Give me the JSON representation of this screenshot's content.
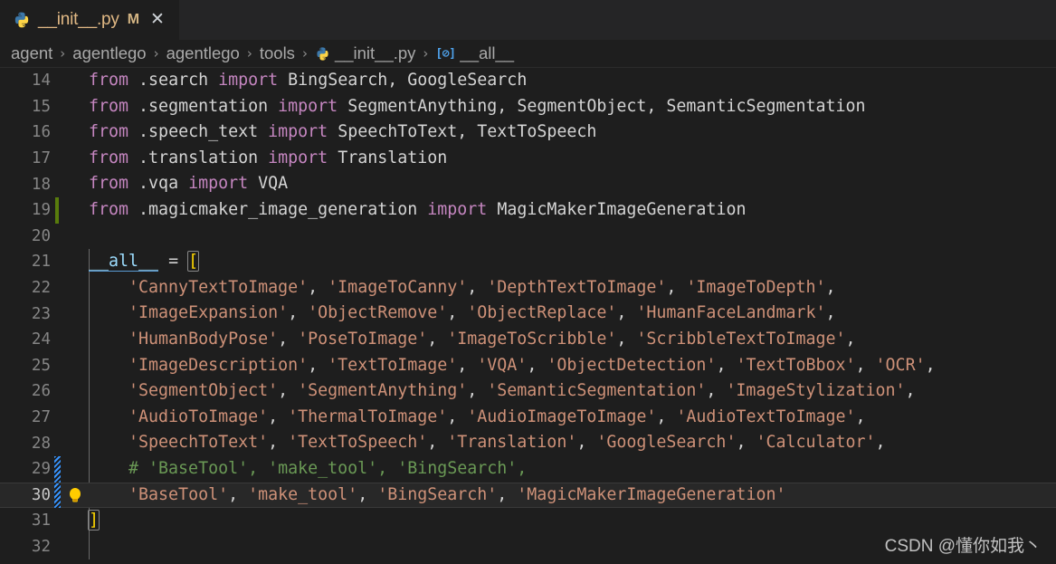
{
  "tab": {
    "icon": "python-file-icon",
    "filename": "__init__.py",
    "dirty_badge": "M",
    "close_label": "✕"
  },
  "breadcrumb": {
    "separator": "›",
    "items": [
      {
        "label": "agent",
        "icon": null
      },
      {
        "label": "agentlego",
        "icon": null
      },
      {
        "label": "agentlego",
        "icon": null
      },
      {
        "label": "tools",
        "icon": null
      },
      {
        "label": "__init__.py",
        "icon": "python-file-icon"
      },
      {
        "label": "__all__",
        "icon": "variable-symbol-icon"
      }
    ],
    "symbol_glyph": "[⊘]"
  },
  "editor": {
    "language": "python",
    "active_line": 30,
    "lines": [
      {
        "n": 14,
        "gutter": "none",
        "bulb": false,
        "tokens": [
          {
            "t": "from",
            "c": "kw"
          },
          {
            "t": " ",
            "c": "punc"
          },
          {
            "t": ".search",
            "c": "mod"
          },
          {
            "t": " ",
            "c": "punc"
          },
          {
            "t": "import",
            "c": "kw"
          },
          {
            "t": " ",
            "c": "punc"
          },
          {
            "t": "BingSearch, GoogleSearch",
            "c": "name"
          }
        ]
      },
      {
        "n": 15,
        "gutter": "none",
        "bulb": false,
        "tokens": [
          {
            "t": "from",
            "c": "kw"
          },
          {
            "t": " ",
            "c": "punc"
          },
          {
            "t": ".segmentation",
            "c": "mod"
          },
          {
            "t": " ",
            "c": "punc"
          },
          {
            "t": "import",
            "c": "kw"
          },
          {
            "t": " ",
            "c": "punc"
          },
          {
            "t": "SegmentAnything, SegmentObject, SemanticSegmentation",
            "c": "name"
          }
        ]
      },
      {
        "n": 16,
        "gutter": "none",
        "bulb": false,
        "tokens": [
          {
            "t": "from",
            "c": "kw"
          },
          {
            "t": " ",
            "c": "punc"
          },
          {
            "t": ".speech_text",
            "c": "mod"
          },
          {
            "t": " ",
            "c": "punc"
          },
          {
            "t": "import",
            "c": "kw"
          },
          {
            "t": " ",
            "c": "punc"
          },
          {
            "t": "SpeechToText, TextToSpeech",
            "c": "name"
          }
        ]
      },
      {
        "n": 17,
        "gutter": "none",
        "bulb": false,
        "tokens": [
          {
            "t": "from",
            "c": "kw"
          },
          {
            "t": " ",
            "c": "punc"
          },
          {
            "t": ".translation",
            "c": "mod"
          },
          {
            "t": " ",
            "c": "punc"
          },
          {
            "t": "import",
            "c": "kw"
          },
          {
            "t": " ",
            "c": "punc"
          },
          {
            "t": "Translation",
            "c": "name"
          }
        ]
      },
      {
        "n": 18,
        "gutter": "none",
        "bulb": false,
        "tokens": [
          {
            "t": "from",
            "c": "kw"
          },
          {
            "t": " ",
            "c": "punc"
          },
          {
            "t": ".vqa",
            "c": "mod"
          },
          {
            "t": " ",
            "c": "punc"
          },
          {
            "t": "import",
            "c": "kw"
          },
          {
            "t": " ",
            "c": "punc"
          },
          {
            "t": "VQA",
            "c": "name"
          }
        ]
      },
      {
        "n": 19,
        "gutter": "added",
        "bulb": false,
        "tokens": [
          {
            "t": "from",
            "c": "kw"
          },
          {
            "t": " ",
            "c": "punc"
          },
          {
            "t": ".magicmaker_image_generation",
            "c": "mod"
          },
          {
            "t": " ",
            "c": "punc"
          },
          {
            "t": "import",
            "c": "kw"
          },
          {
            "t": " ",
            "c": "punc"
          },
          {
            "t": "MagicMakerImageGeneration",
            "c": "name"
          }
        ]
      },
      {
        "n": 20,
        "gutter": "none",
        "bulb": false,
        "tokens": []
      },
      {
        "n": 21,
        "gutter": "none",
        "bulb": false,
        "tokens": [
          {
            "t": "__all__",
            "c": "var underline-sym"
          },
          {
            "t": " ",
            "c": "punc"
          },
          {
            "t": "=",
            "c": "op"
          },
          {
            "t": " ",
            "c": "punc"
          },
          {
            "t": "[",
            "c": "brk brk-match"
          }
        ]
      },
      {
        "n": 22,
        "gutter": "none",
        "bulb": false,
        "tokens": [
          {
            "t": "    ",
            "c": "punc"
          },
          {
            "t": "'CannyTextToImage'",
            "c": "str"
          },
          {
            "t": ", ",
            "c": "punc"
          },
          {
            "t": "'ImageToCanny'",
            "c": "str"
          },
          {
            "t": ", ",
            "c": "punc"
          },
          {
            "t": "'DepthTextToImage'",
            "c": "str"
          },
          {
            "t": ", ",
            "c": "punc"
          },
          {
            "t": "'ImageToDepth'",
            "c": "str"
          },
          {
            "t": ",",
            "c": "punc"
          }
        ]
      },
      {
        "n": 23,
        "gutter": "none",
        "bulb": false,
        "tokens": [
          {
            "t": "    ",
            "c": "punc"
          },
          {
            "t": "'ImageExpansion'",
            "c": "str"
          },
          {
            "t": ", ",
            "c": "punc"
          },
          {
            "t": "'ObjectRemove'",
            "c": "str"
          },
          {
            "t": ", ",
            "c": "punc"
          },
          {
            "t": "'ObjectReplace'",
            "c": "str"
          },
          {
            "t": ", ",
            "c": "punc"
          },
          {
            "t": "'HumanFaceLandmark'",
            "c": "str"
          },
          {
            "t": ",",
            "c": "punc"
          }
        ]
      },
      {
        "n": 24,
        "gutter": "none",
        "bulb": false,
        "tokens": [
          {
            "t": "    ",
            "c": "punc"
          },
          {
            "t": "'HumanBodyPose'",
            "c": "str"
          },
          {
            "t": ", ",
            "c": "punc"
          },
          {
            "t": "'PoseToImage'",
            "c": "str"
          },
          {
            "t": ", ",
            "c": "punc"
          },
          {
            "t": "'ImageToScribble'",
            "c": "str"
          },
          {
            "t": ", ",
            "c": "punc"
          },
          {
            "t": "'ScribbleTextToImage'",
            "c": "str"
          },
          {
            "t": ",",
            "c": "punc"
          }
        ]
      },
      {
        "n": 25,
        "gutter": "none",
        "bulb": false,
        "tokens": [
          {
            "t": "    ",
            "c": "punc"
          },
          {
            "t": "'ImageDescription'",
            "c": "str"
          },
          {
            "t": ", ",
            "c": "punc"
          },
          {
            "t": "'TextToImage'",
            "c": "str"
          },
          {
            "t": ", ",
            "c": "punc"
          },
          {
            "t": "'VQA'",
            "c": "str"
          },
          {
            "t": ", ",
            "c": "punc"
          },
          {
            "t": "'ObjectDetection'",
            "c": "str"
          },
          {
            "t": ", ",
            "c": "punc"
          },
          {
            "t": "'TextToBbox'",
            "c": "str"
          },
          {
            "t": ", ",
            "c": "punc"
          },
          {
            "t": "'OCR'",
            "c": "str"
          },
          {
            "t": ",",
            "c": "punc"
          }
        ]
      },
      {
        "n": 26,
        "gutter": "none",
        "bulb": false,
        "tokens": [
          {
            "t": "    ",
            "c": "punc"
          },
          {
            "t": "'SegmentObject'",
            "c": "str"
          },
          {
            "t": ", ",
            "c": "punc"
          },
          {
            "t": "'SegmentAnything'",
            "c": "str"
          },
          {
            "t": ", ",
            "c": "punc"
          },
          {
            "t": "'SemanticSegmentation'",
            "c": "str"
          },
          {
            "t": ", ",
            "c": "punc"
          },
          {
            "t": "'ImageStylization'",
            "c": "str"
          },
          {
            "t": ",",
            "c": "punc"
          }
        ]
      },
      {
        "n": 27,
        "gutter": "none",
        "bulb": false,
        "tokens": [
          {
            "t": "    ",
            "c": "punc"
          },
          {
            "t": "'AudioToImage'",
            "c": "str"
          },
          {
            "t": ", ",
            "c": "punc"
          },
          {
            "t": "'ThermalToImage'",
            "c": "str"
          },
          {
            "t": ", ",
            "c": "punc"
          },
          {
            "t": "'AudioImageToImage'",
            "c": "str"
          },
          {
            "t": ", ",
            "c": "punc"
          },
          {
            "t": "'AudioTextToImage'",
            "c": "str"
          },
          {
            "t": ",",
            "c": "punc"
          }
        ]
      },
      {
        "n": 28,
        "gutter": "none",
        "bulb": false,
        "tokens": [
          {
            "t": "    ",
            "c": "punc"
          },
          {
            "t": "'SpeechToText'",
            "c": "str"
          },
          {
            "t": ", ",
            "c": "punc"
          },
          {
            "t": "'TextToSpeech'",
            "c": "str"
          },
          {
            "t": ", ",
            "c": "punc"
          },
          {
            "t": "'Translation'",
            "c": "str"
          },
          {
            "t": ", ",
            "c": "punc"
          },
          {
            "t": "'GoogleSearch'",
            "c": "str"
          },
          {
            "t": ", ",
            "c": "punc"
          },
          {
            "t": "'Calculator'",
            "c": "str"
          },
          {
            "t": ",",
            "c": "punc"
          }
        ]
      },
      {
        "n": 29,
        "gutter": "striped",
        "bulb": false,
        "tokens": [
          {
            "t": "    # 'BaseTool', 'make_tool', 'BingSearch',",
            "c": "cmt"
          }
        ]
      },
      {
        "n": 30,
        "gutter": "striped",
        "bulb": true,
        "tokens": [
          {
            "t": "    ",
            "c": "punc"
          },
          {
            "t": "'BaseTool'",
            "c": "str"
          },
          {
            "t": ", ",
            "c": "punc"
          },
          {
            "t": "'make_tool'",
            "c": "str"
          },
          {
            "t": ", ",
            "c": "punc"
          },
          {
            "t": "'BingSearch'",
            "c": "str"
          },
          {
            "t": ", ",
            "c": "punc"
          },
          {
            "t": "'MagicMakerImageGeneration'",
            "c": "str"
          }
        ]
      },
      {
        "n": 31,
        "gutter": "none",
        "bulb": false,
        "tokens": [
          {
            "t": "]",
            "c": "brk brk-match"
          }
        ]
      },
      {
        "n": 32,
        "gutter": "none",
        "bulb": false,
        "tokens": []
      }
    ]
  },
  "watermark": {
    "text": "CSDN @懂你如我丶"
  },
  "colors": {
    "editor_bg": "#1e1e1e",
    "tabbar_bg": "#252526",
    "keyword": "#c586c0",
    "string": "#ce9178",
    "comment": "#6a9955",
    "variable": "#9cdcfe",
    "bracket": "#ffd700",
    "line_number": "#858585",
    "active_line_bg": "#282828",
    "added_gutter": "#587c0c",
    "modified_gutter": "#3794ff",
    "bulb": "#ffcc00"
  }
}
